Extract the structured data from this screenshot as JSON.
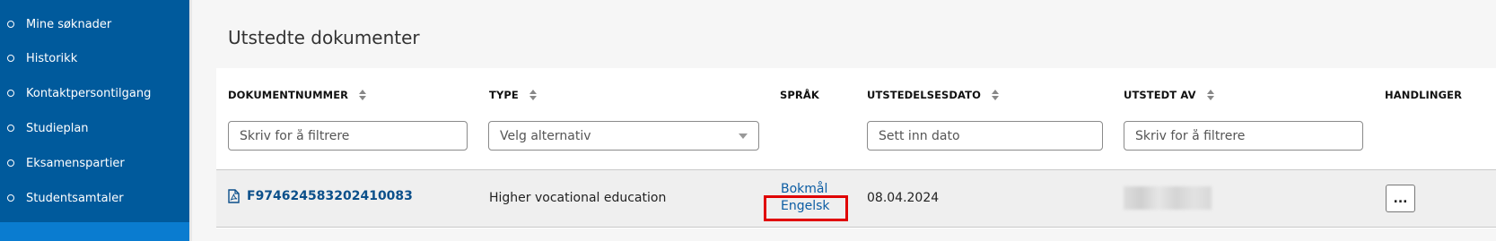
{
  "sidebar": {
    "items": [
      {
        "label": "Mine søknader"
      },
      {
        "label": "Historikk"
      },
      {
        "label": "Kontaktpersontilgang"
      },
      {
        "label": "Studieplan"
      },
      {
        "label": "Eksamenspartier"
      },
      {
        "label": "Studentsamtaler"
      }
    ],
    "accent": "#005a9c",
    "active_color": "#0a7cd0"
  },
  "page": {
    "title": "Utstedte dokumenter"
  },
  "table": {
    "headers": {
      "document_number": "DOKUMENTNUMMER",
      "type": "TYPE",
      "language": "SPRÅK",
      "issue_date": "UTSTEDELSESDATO",
      "issued_by": "UTSTEDT AV",
      "actions": "HANDLINGER"
    },
    "filters": {
      "document_number_placeholder": "Skriv for å filtrere",
      "type_placeholder": "Velg alternativ",
      "issue_date_placeholder": "Sett inn dato",
      "issued_by_placeholder": "Skriv for å filtrere"
    },
    "rows": [
      {
        "document_number": "F974624583202410083",
        "type": "Higher vocational education",
        "languages": [
          "Bokmål",
          "Engelsk"
        ],
        "issue_date": "08.04.2024",
        "issued_by": "",
        "actions_label": "..."
      }
    ]
  },
  "icons": {
    "document": "pdf-document-icon",
    "sort": "sort-icon",
    "menu": "more-options-icon"
  },
  "highlight_color": "#e00000"
}
